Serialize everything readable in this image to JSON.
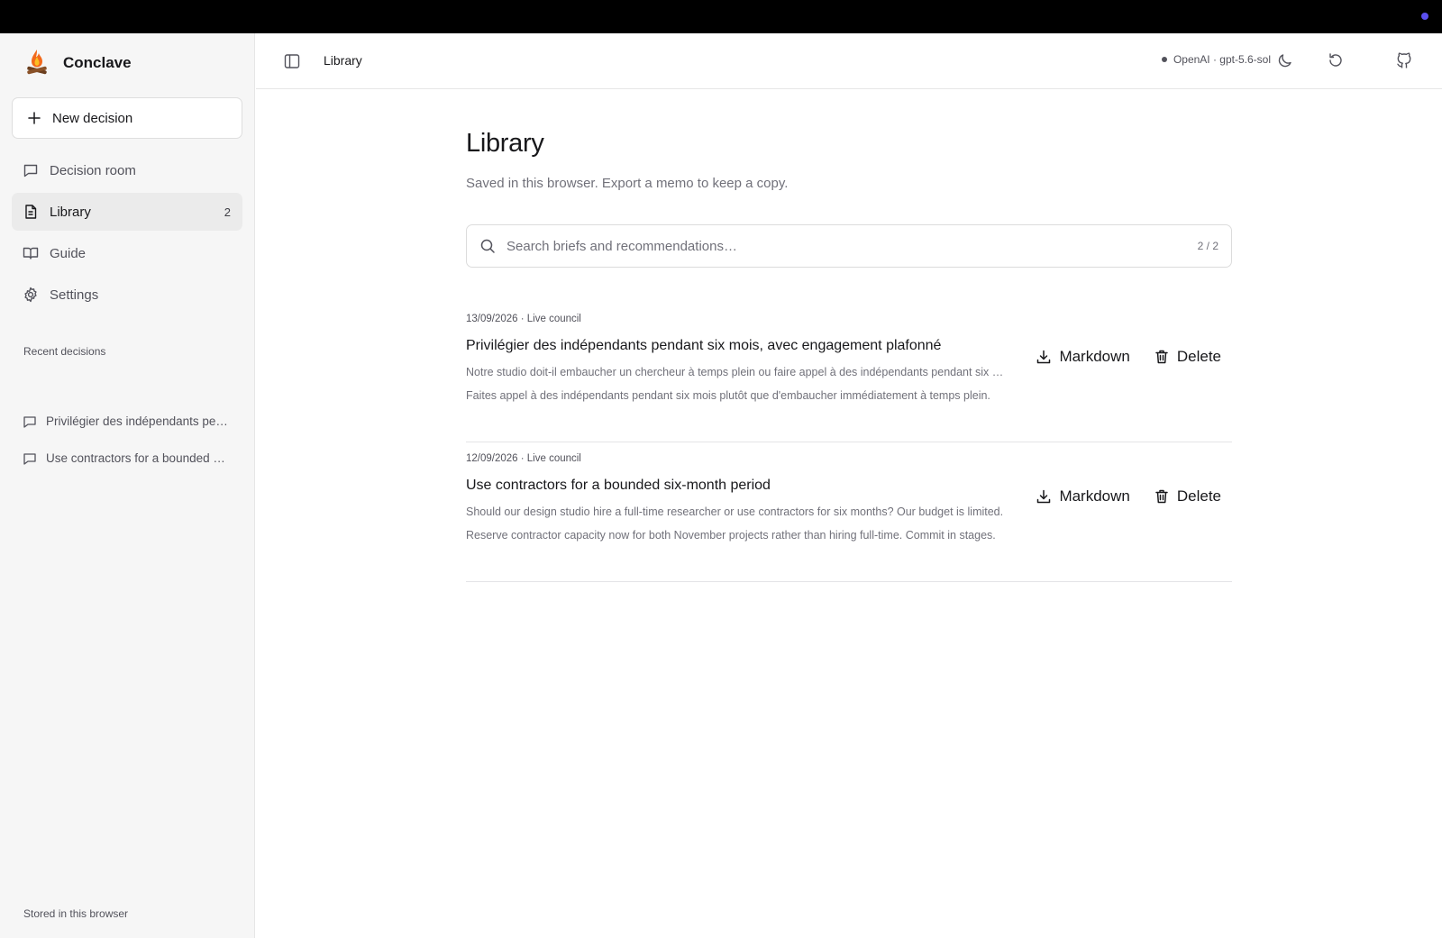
{
  "app": {
    "name": "Conclave"
  },
  "sidebar": {
    "new_decision": "New decision",
    "nav": [
      {
        "label": "Decision room",
        "icon": "message-square-icon"
      },
      {
        "label": "Library",
        "icon": "file-text-icon",
        "count": "2",
        "active": true
      },
      {
        "label": "Guide",
        "icon": "book-open-icon"
      },
      {
        "label": "Settings",
        "icon": "gear-icon"
      }
    ],
    "recent_title": "Recent decisions",
    "recent": [
      {
        "label": "Privilégier des indépendants pendant six mois, avec engagement plafonné"
      },
      {
        "label": "Use contractors for a bounded six-month period"
      }
    ],
    "footer": "Stored in this browser"
  },
  "header": {
    "breadcrumb": "Library",
    "model_label": "OpenAI · gpt-5.6-sol",
    "model_status_color": "#52525b"
  },
  "main": {
    "title": "Library",
    "subtitle": "Saved in this browser. Export a memo to keep a copy.",
    "search": {
      "placeholder": "Search briefs and recommendations…",
      "value": "",
      "counter": "2 / 2"
    },
    "items": [
      {
        "meta": "13/09/2026 · Live council",
        "title": "Privilégier des indépendants pendant six mois, avec engagement plafonné",
        "question": "Notre studio doit-il embaucher un chercheur à temps plein ou faire appel à des indépendants pendant six mois ?",
        "recommendation": "Faites appel à des indépendants pendant six mois plutôt que d'embaucher immédiatement à temps plein.",
        "markdown_label": "Markdown",
        "delete_label": "Delete"
      },
      {
        "meta": "12/09/2026 · Live council",
        "title": "Use contractors for a bounded six-month period",
        "question": "Should our design studio hire a full-time researcher or use contractors for six months? Our budget is limited.",
        "recommendation": "Reserve contractor capacity now for both November projects rather than hiring full-time. Commit in stages.",
        "markdown_label": "Markdown",
        "delete_label": "Delete"
      }
    ]
  },
  "colors": {
    "accent_dot": "#5b4ff0",
    "sidebar_bg": "#f6f6f6",
    "active_nav_bg": "#ebebeb"
  }
}
